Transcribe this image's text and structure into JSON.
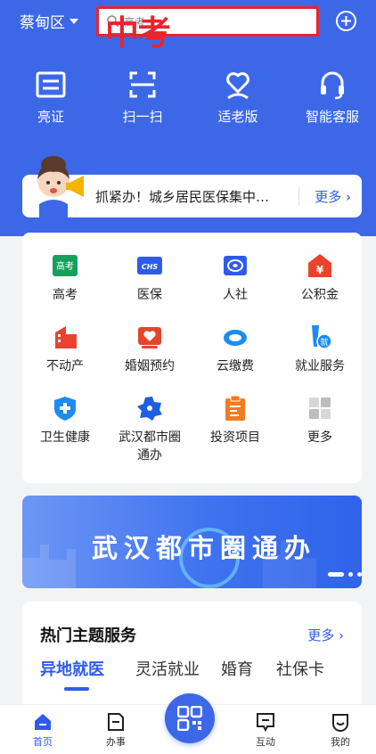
{
  "topbar": {
    "city": "蔡甸区",
    "search_placeholder": "高考",
    "overlay_text": "中考"
  },
  "quick_actions": [
    {
      "label": "亮证",
      "icon": "id-card-icon"
    },
    {
      "label": "扫一扫",
      "icon": "scan-icon"
    },
    {
      "label": "适老版",
      "icon": "elderly-heart-icon"
    },
    {
      "label": "智能客服",
      "icon": "headset-icon"
    }
  ],
  "notice": {
    "text": "抓紧办！城乡居民医保集中…",
    "more": "更多"
  },
  "services": [
    {
      "label": "高考",
      "icon": "gaokao-icon",
      "badge": "高考"
    },
    {
      "label": "医保",
      "icon": "chs-icon",
      "badge": "CHS"
    },
    {
      "label": "人社",
      "icon": "social-security-icon"
    },
    {
      "label": "公积金",
      "icon": "housing-fund-icon"
    },
    {
      "label": "不动产",
      "icon": "real-estate-icon"
    },
    {
      "label": "婚姻预约",
      "icon": "marriage-icon"
    },
    {
      "label": "云缴费",
      "icon": "cloud-pay-icon"
    },
    {
      "label": "就业服务",
      "icon": "employment-icon",
      "badge": "就"
    },
    {
      "label": "卫生健康",
      "icon": "health-icon"
    },
    {
      "label": "武汉都市圈\n通办",
      "label_line1": "武汉都市圈",
      "label_line2": "通办",
      "icon": "wuhan-map-icon"
    },
    {
      "label": "投资项目",
      "icon": "investment-icon"
    },
    {
      "label": "更多",
      "icon": "more-grid-icon"
    }
  ],
  "banner": {
    "title": "武汉都市圈通办"
  },
  "hot": {
    "title": "热门主题服务",
    "more": "更多",
    "tabs": [
      "异地就医",
      "灵活就业",
      "婚育",
      "社保卡"
    ]
  },
  "bottom_nav": [
    {
      "label": "首页",
      "icon": "home-icon"
    },
    {
      "label": "办事",
      "icon": "document-icon"
    },
    {
      "label": "",
      "icon": "qr-scan-icon"
    },
    {
      "label": "互动",
      "icon": "chat-icon"
    },
    {
      "label": "我的",
      "icon": "profile-icon"
    }
  ],
  "colors": {
    "brand_blue": "#3c68e8",
    "link_blue": "#2f5bea",
    "annotation_red": "#e8242d"
  }
}
